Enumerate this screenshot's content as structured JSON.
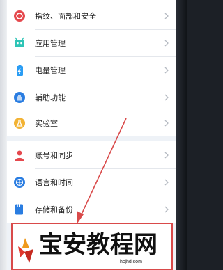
{
  "settings": {
    "group1": [
      {
        "label": "指纹、面部和安全",
        "icon": "fingerprint-security-icon",
        "color": "#e5484d"
      },
      {
        "label": "应用管理",
        "icon": "app-management-icon",
        "color": "#2ec4b6"
      },
      {
        "label": "电量管理",
        "icon": "battery-icon",
        "color": "#2a9df4"
      },
      {
        "label": "辅助功能",
        "icon": "accessibility-hand-icon",
        "color": "#2a7de1"
      },
      {
        "label": "实验室",
        "icon": "lab-flask-icon",
        "color": "#f2b233"
      }
    ],
    "group2": [
      {
        "label": "账号和同步",
        "icon": "account-person-icon",
        "color": "#e5484d"
      },
      {
        "label": "语言和时间",
        "icon": "language-globe-icon",
        "color": "#2a7de1"
      },
      {
        "label": "存储和备份",
        "icon": "storage-icon",
        "color": "#2a7de1"
      }
    ]
  },
  "watermark": {
    "title": "宝安教程网",
    "site": "hcjhd.com"
  },
  "colors": {
    "annotation_red": "#d94a4a",
    "chevron": "#b5bac2"
  }
}
